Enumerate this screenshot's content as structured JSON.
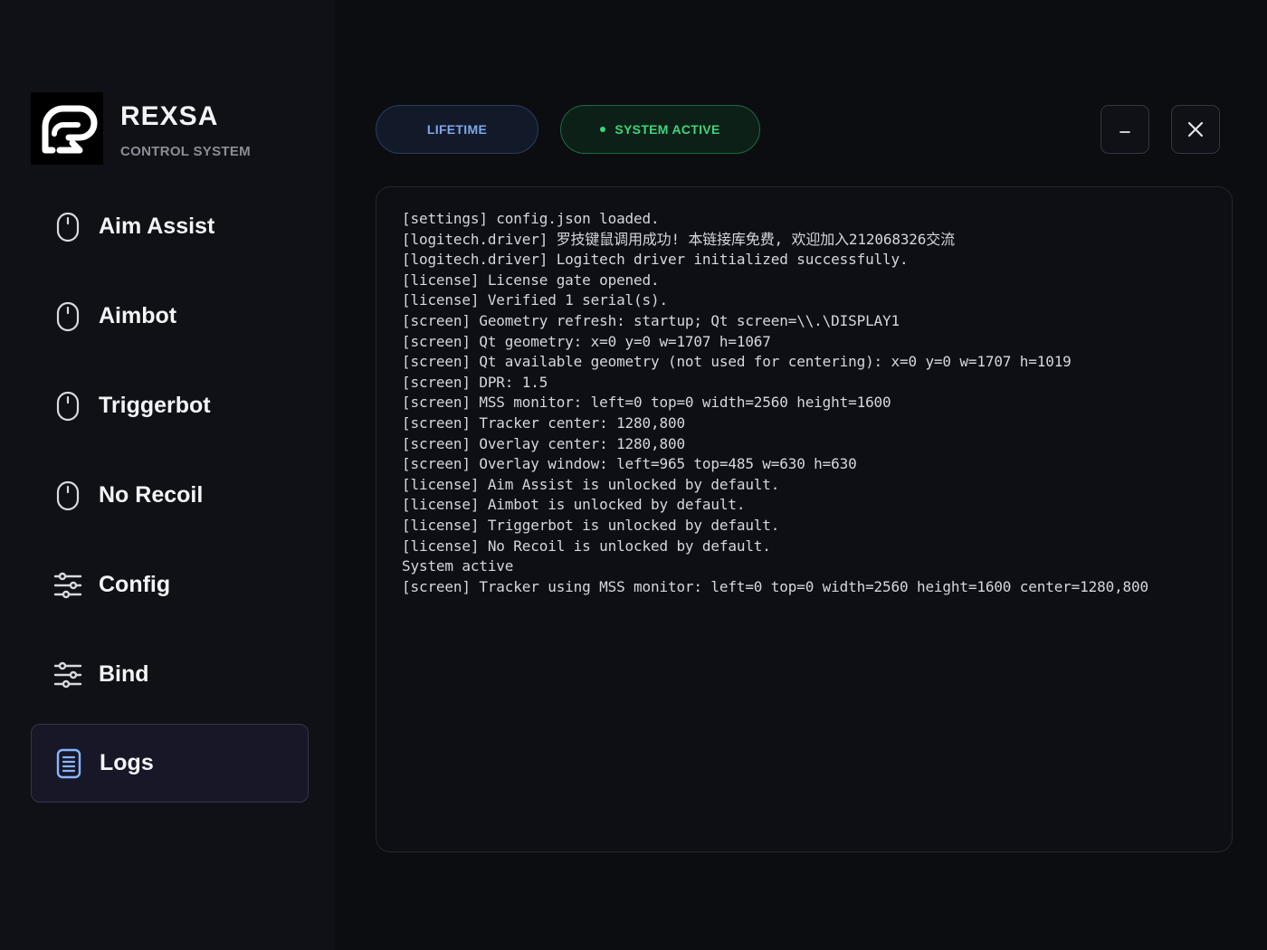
{
  "brand": {
    "name": "REXSA",
    "subtitle": "CONTROL SYSTEM"
  },
  "nav": [
    {
      "label": "Aim Assist",
      "icon": "mouse-icon",
      "active": false
    },
    {
      "label": "Aimbot",
      "icon": "mouse-icon",
      "active": false
    },
    {
      "label": "Triggerbot",
      "icon": "mouse-icon",
      "active": false
    },
    {
      "label": "No Recoil",
      "icon": "mouse-icon",
      "active": false
    },
    {
      "label": "Config",
      "icon": "sliders-icon",
      "active": false
    },
    {
      "label": "Bind",
      "icon": "sliders-icon",
      "active": false
    },
    {
      "label": "Logs",
      "icon": "document-icon",
      "active": true
    }
  ],
  "header": {
    "license_badge": "LIFETIME",
    "status_badge": "SYSTEM ACTIVE",
    "minimize_label": "–",
    "close_label": "✕"
  },
  "colors": {
    "background": "#0c0d11",
    "sidebar": "#101116",
    "status_green": "#3fd47a",
    "license_blue": "#7fa6e8"
  },
  "logs": [
    "[settings] config.json loaded.",
    "[logitech.driver] 罗技键鼠调用成功! 本链接库免费, 欢迎加入212068326交流",
    "[logitech.driver] Logitech driver initialized successfully.",
    "[license] License gate opened.",
    "[license] Verified 1 serial(s).",
    "[screen] Geometry refresh: startup; Qt screen=\\\\.\\DISPLAY1",
    "[screen] Qt geometry: x=0 y=0 w=1707 h=1067",
    "[screen] Qt available geometry (not used for centering): x=0 y=0 w=1707 h=1019",
    "[screen] DPR: 1.5",
    "[screen] MSS monitor: left=0 top=0 width=2560 height=1600",
    "[screen] Tracker center: 1280,800",
    "[screen] Overlay center: 1280,800",
    "[screen] Overlay window: left=965 top=485 w=630 h=630",
    "[license] Aim Assist is unlocked by default.",
    "[license] Aimbot is unlocked by default.",
    "[license] Triggerbot is unlocked by default.",
    "[license] No Recoil is unlocked by default.",
    "System active",
    "[screen] Tracker using MSS monitor: left=0 top=0 width=2560 height=1600 center=1280,800"
  ]
}
